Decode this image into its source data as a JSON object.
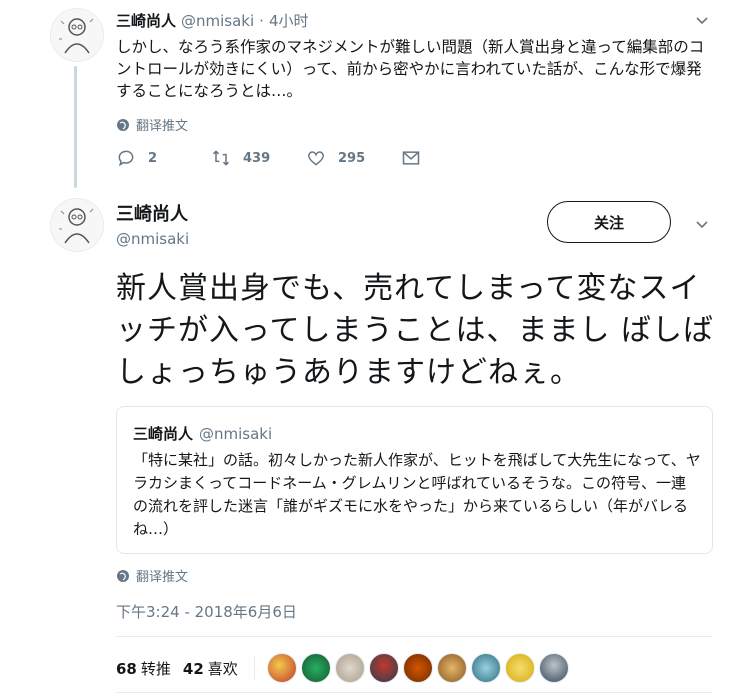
{
  "parent_tweet": {
    "author_name": "三崎尚人",
    "handle": "@nmisaki",
    "separator": "·",
    "time": "4小时",
    "text": "しかし、なろう系作家のマネジメントが難しい問題（新人賞出身と違って編集部のコントロールが効きにくい）って、前から密やかに言われていた話が、こんな形で爆発することになろうとは…。",
    "translate_label": "翻译推文",
    "replies": "2",
    "retweets": "439",
    "likes": "295"
  },
  "main_tweet": {
    "author_name": "三崎尚人",
    "handle": "@nmisaki",
    "follow_label": "关注",
    "text": "新人賞出身でも、売れてしまって変なスイッチが入ってしまうことは、ままします ばしょっちゅうありますけどねぇ。",
    "text_display": "新人賞出身でも、売れてしまって変なスイッチが入ってしまうことは、ままし ばしばしょっちゅうありますけどねぇ。",
    "translate_label": "翻译推文",
    "timestamp": "下午3:24 - 2018年6月6日",
    "retweet_count": "68",
    "retweet_label": "转推",
    "like_count": "42",
    "like_label": "喜欢"
  },
  "quoted_tweet": {
    "author_name": "三崎尚人",
    "handle": "@nmisaki",
    "text": "「特に某社」の話。初々しかった新人作家が、ヒットを飛ばして大先生になって、ヤラカシまくってコードネーム・グレムリンと呼ばれているそうな。この符号、一連の流れを評した迷言「誰がギズモに水をやった」から来ているらしい（年がバレるね…）"
  },
  "icons": {
    "reply": "reply-icon",
    "retweet": "retweet-icon",
    "like": "heart-icon",
    "dm": "envelope-icon",
    "globe": "globe-icon",
    "more": "chevron-down-icon"
  },
  "colors": {
    "muted": "#657786",
    "border": "#e1e8ed",
    "thread_line": "#ccd6dd",
    "text": "#14171a"
  }
}
